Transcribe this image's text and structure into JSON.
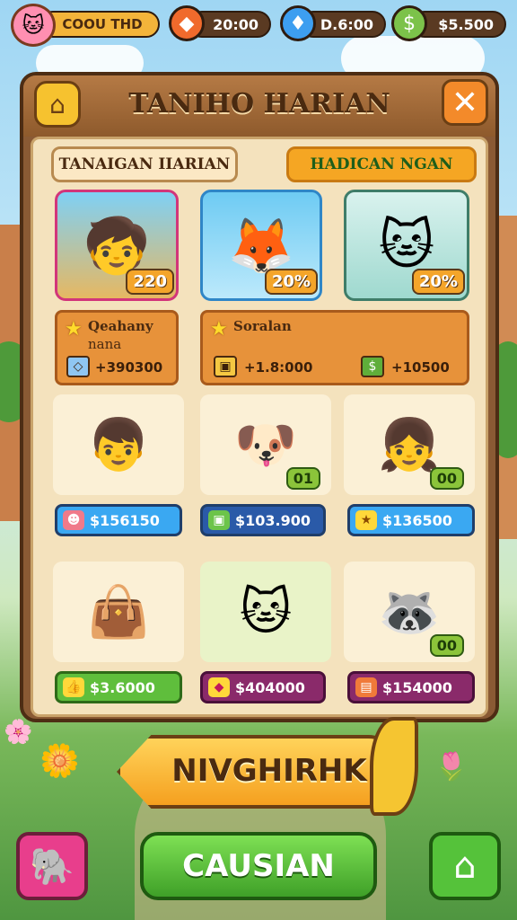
{
  "player": {
    "name": "COOU THD"
  },
  "currencies": [
    {
      "icon": "fire-gem-icon",
      "value": "20:00"
    },
    {
      "icon": "blue-gem-icon",
      "value": "D.6:00"
    },
    {
      "icon": "cash-icon",
      "value": "$5.500"
    }
  ],
  "panel": {
    "title": "TANIHO HARIAN",
    "tabs": [
      {
        "label": "TANAIGAN IIARIAN"
      },
      {
        "label": "HADICAN NGAN"
      }
    ],
    "featured": [
      {
        "badge": "220"
      },
      {
        "badge": "20%"
      },
      {
        "badge": "20%"
      }
    ],
    "info_left": {
      "title": "Qeahany",
      "subtitle": "nana",
      "value": "+390300"
    },
    "info_right": {
      "title": "Soralan",
      "value_a": "+1.8:000",
      "value_b": "+10500"
    },
    "items": [
      {
        "coin": "",
        "price": "$156150",
        "style": "blue"
      },
      {
        "coin": "01",
        "price": "$103.900",
        "style": "navy"
      },
      {
        "coin": "00",
        "price": "$136500",
        "style": "blue"
      },
      {
        "coin": "",
        "price": "$3.6000",
        "style": "green"
      },
      {
        "coin": "",
        "price": "$404000",
        "style": "purple"
      },
      {
        "coin": "00",
        "price": "$154000",
        "style": "purple"
      }
    ]
  },
  "banner": {
    "label": "NIVGHIRHK"
  },
  "main_button": {
    "label": "CAUSIAN"
  }
}
